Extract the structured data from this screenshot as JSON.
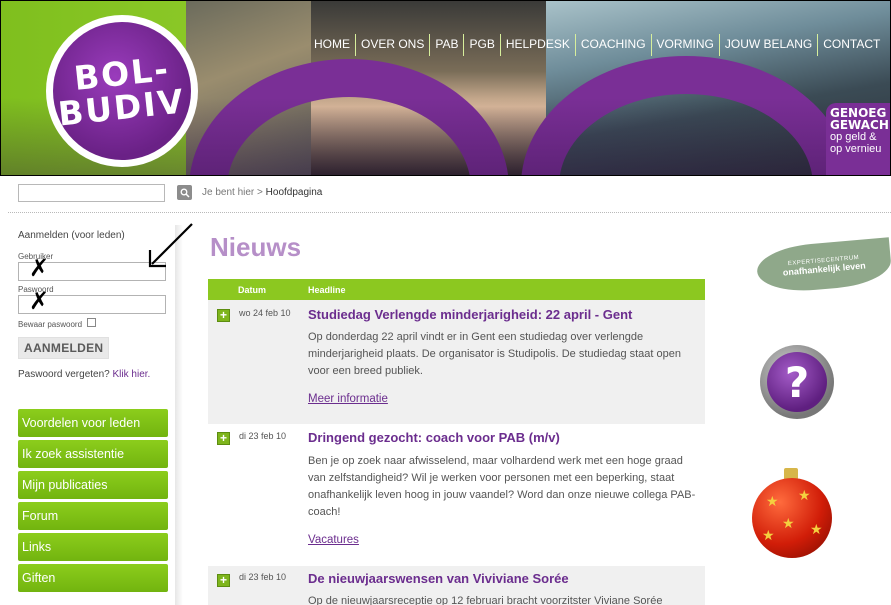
{
  "header": {
    "logo_line1": "BOL-",
    "logo_line2": "BUDIV",
    "nav": [
      "HOME",
      "OVER ONS",
      "PAB",
      "PGB",
      "HELPDESK",
      "COACHING",
      "VORMING",
      "JOUW BELANG",
      "CONTACT"
    ],
    "badge_line1": "GENOEG",
    "badge_line2": "GEWACH",
    "badge_line3": "op geld &",
    "badge_line4": "op vernieu"
  },
  "search": {
    "value": ""
  },
  "breadcrumb": {
    "prefix": "Je bent hier >",
    "current": "Hoofdpagina"
  },
  "login": {
    "title": "Aanmelden (voor leden)",
    "user_label": "Gebruiker",
    "password_label": "Paswoord",
    "remember_label": "Bewaar paswoord",
    "button_label": "AANMELDEN",
    "forgot_text": "Paswoord vergeten?",
    "forgot_link": "Klik hier."
  },
  "sidemenu": [
    "Voordelen voor leden",
    "Ik zoek assistentie",
    "Mijn publicaties",
    "Forum",
    "Links",
    "Giften"
  ],
  "news": {
    "title": "Nieuws",
    "col_date": "Datum",
    "col_headline": "Headline",
    "items": [
      {
        "date": "wo 24 feb 10",
        "title": "Studiedag Verlengde minderjarigheid: 22 april - Gent",
        "body": "Op donderdag 22 april vindt er in Gent een studiedag over verlengde minderjarigheid plaats. De organisator is Studipolis. De studiedag staat open voor een breed publiek.",
        "link": "Meer informatie"
      },
      {
        "date": "di 23 feb 10",
        "title": "Dringend gezocht: coach voor PAB (m/v)",
        "body": "Ben je op zoek naar afwisselend, maar volhardend werk met een hoge graad van zelfstandigheid? Wil je werken voor personen met een beperking, staat onafhankelijk leven hoog in jouw vaandel? Word dan onze nieuwe collega PAB-coach!",
        "link": "Vacatures"
      },
      {
        "date": "di 23 feb 10",
        "title": "De nieuwjaarswensen van Viviviane Sorée",
        "body": "Op de nieuwjaarsreceptie op 12 februari bracht voorzitster Viviane Sorée",
        "link": ""
      }
    ]
  },
  "right": {
    "leaf_line1": "EXPERTISECENTRUM",
    "leaf_line2": "onafhankelijk leven",
    "help_symbol": "?"
  },
  "colors": {
    "green": "#8cc820",
    "purple": "#6b2d8e",
    "news_title": "#b68fc8"
  }
}
